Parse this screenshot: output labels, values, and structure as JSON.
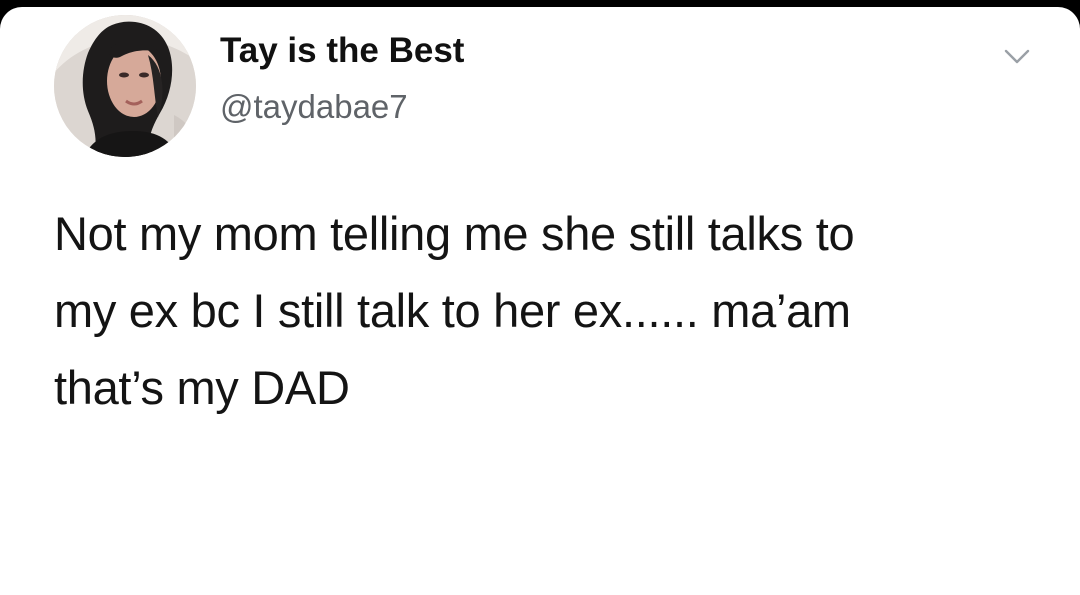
{
  "tweet": {
    "author": {
      "display_name": "Tay is the Best",
      "handle": "@taydabae7",
      "avatar_icon": "profile-photo"
    },
    "text_lines": [
      "Not my mom telling me she still talks to",
      "my ex bc I still talk to her ex...... ma’am",
      "that’s my DAD"
    ],
    "menu_icon": "chevron-down-icon"
  },
  "colors": {
    "card_background": "#ffffff",
    "page_background": "#000000",
    "name_text": "#111111",
    "handle_text": "#5f6368",
    "body_text": "#141414",
    "chevron": "#9aa0a6"
  }
}
